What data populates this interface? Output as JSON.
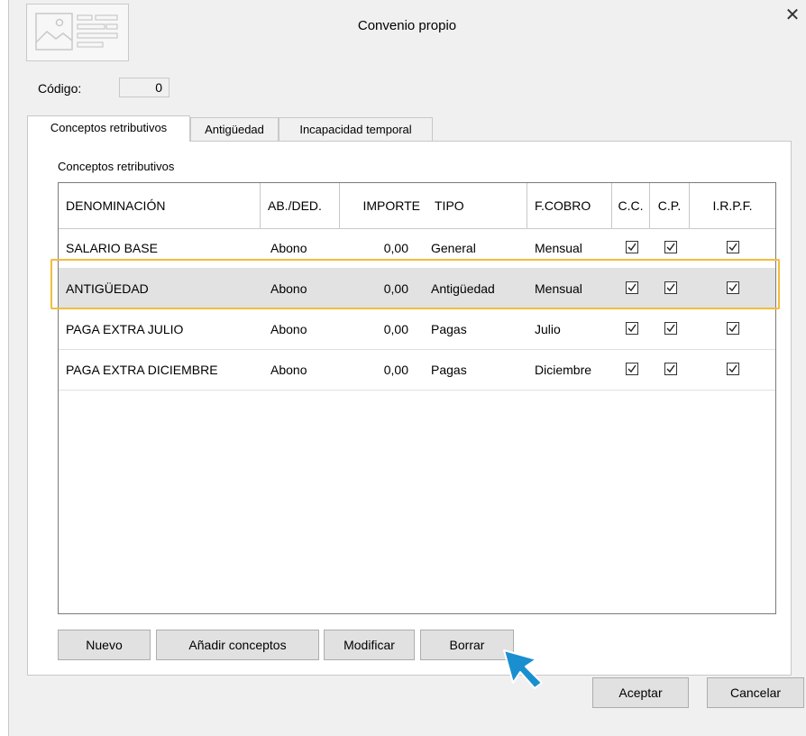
{
  "window": {
    "title": "Convenio propio",
    "close_glyph": "✕"
  },
  "codigo": {
    "label": "Código:",
    "value": "0"
  },
  "tabs": [
    {
      "label": "Conceptos retributivos",
      "active": true
    },
    {
      "label": "Antigüedad",
      "active": false
    },
    {
      "label": "Incapacidad temporal",
      "active": false
    }
  ],
  "panel": {
    "label": "Conceptos retributivos"
  },
  "grid": {
    "columns": [
      "DENOMINACIÓN",
      "AB./DED.",
      "IMPORTE",
      "TIPO",
      "F.COBRO",
      "C.C.",
      "C.P.",
      "I.R.P.F."
    ],
    "rows": [
      {
        "denominacion": "SALARIO BASE",
        "ab_ded": "Abono",
        "importe": "0,00",
        "tipo": "General",
        "f_cobro": "Mensual",
        "cc": true,
        "cp": true,
        "irpf": true,
        "selected": false
      },
      {
        "denominacion": "ANTIGÜEDAD",
        "ab_ded": "Abono",
        "importe": "0,00",
        "tipo": "Antigüedad",
        "f_cobro": "Mensual",
        "cc": true,
        "cp": true,
        "irpf": true,
        "selected": true
      },
      {
        "denominacion": "PAGA EXTRA JULIO",
        "ab_ded": "Abono",
        "importe": "0,00",
        "tipo": "Pagas",
        "f_cobro": "Julio",
        "cc": true,
        "cp": true,
        "irpf": true,
        "selected": false
      },
      {
        "denominacion": "PAGA EXTRA DICIEMBRE",
        "ab_ded": "Abono",
        "importe": "0,00",
        "tipo": "Pagas",
        "f_cobro": "Diciembre",
        "cc": true,
        "cp": true,
        "irpf": true,
        "selected": false
      }
    ]
  },
  "actions": {
    "nuevo": "Nuevo",
    "anadir": "Añadir conceptos",
    "modificar": "Modificar",
    "borrar": "Borrar"
  },
  "footer": {
    "aceptar": "Aceptar",
    "cancelar": "Cancelar"
  },
  "colors": {
    "highlight": "#f3bc3c",
    "selected_row": "#e2e2e2",
    "cursor": "#1a8fd0"
  },
  "icons": {
    "logo": "document-image-icon",
    "cursor": "arrow-cursor-icon",
    "checkbox": "checkbox-checked-icon"
  }
}
